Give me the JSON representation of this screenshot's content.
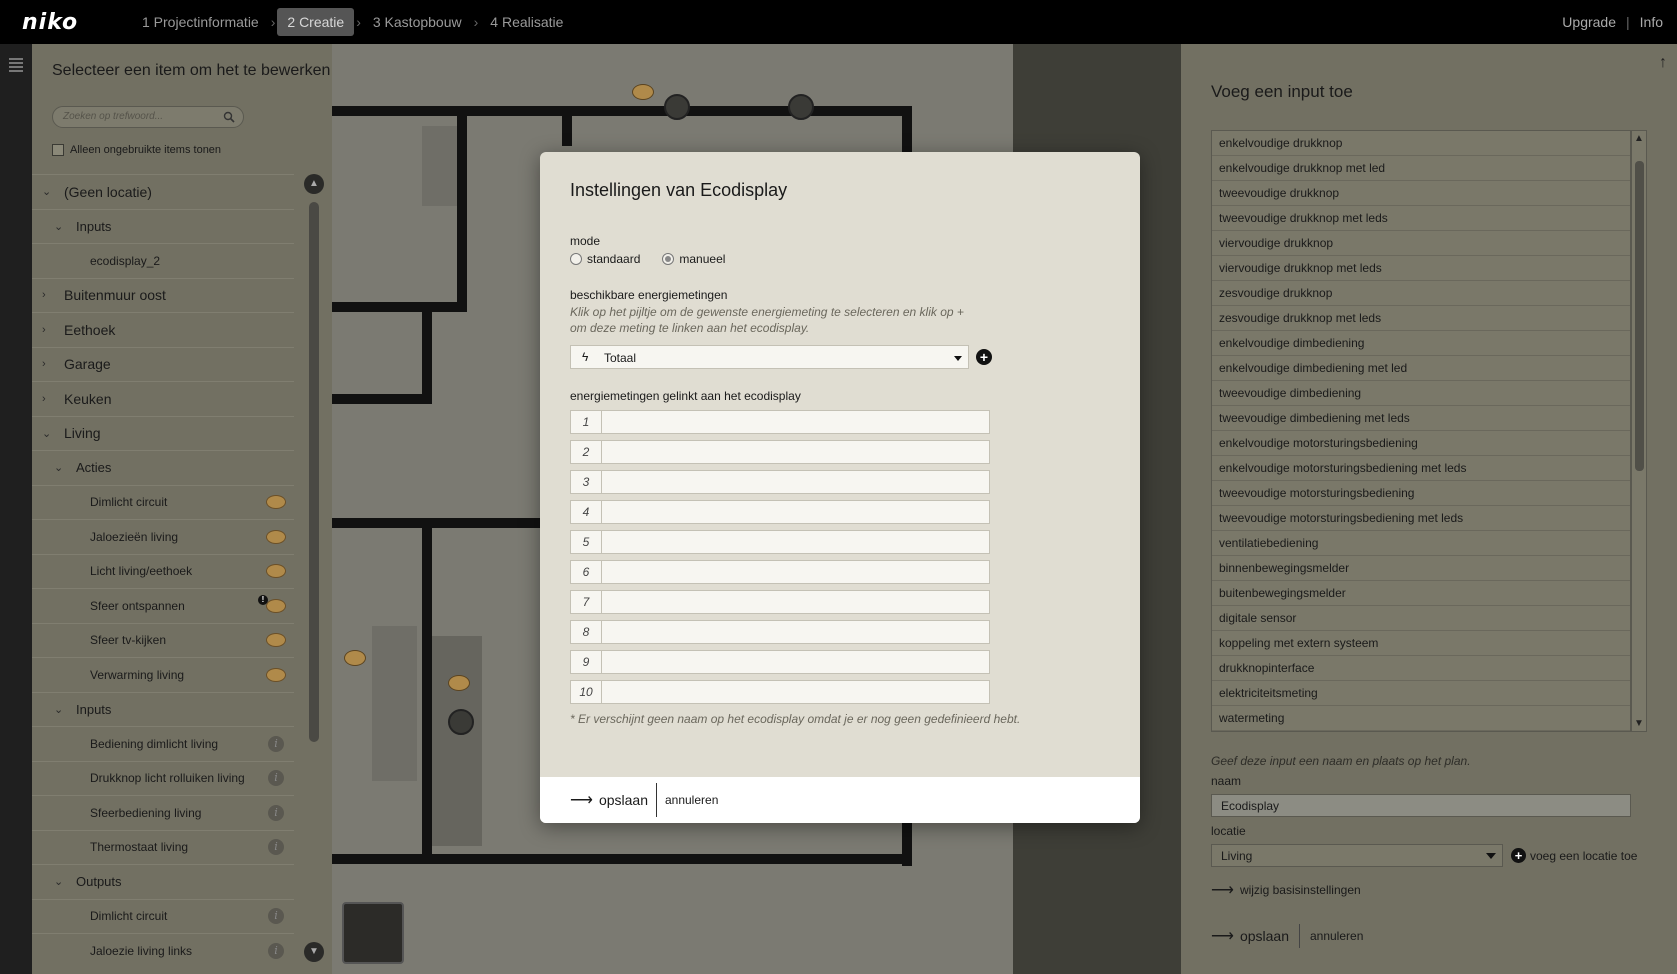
{
  "topbar": {
    "logo": "niko",
    "steps": [
      "1 Projectinformatie",
      "2 Creatie",
      "3 Kastopbouw",
      "4 Realisatie"
    ],
    "upgrade": "Upgrade",
    "info": "Info"
  },
  "left": {
    "title": "Selecteer een item om het te bewerken",
    "search_placeholder": "Zoeken op trefwoord...",
    "unused_only": "Alleen ongebruikte items tonen",
    "tree": [
      {
        "label": "(Geen locatie)",
        "level": 1,
        "arrow": "down"
      },
      {
        "label": "Inputs",
        "level": 2,
        "arrow": "down"
      },
      {
        "label": "ecodisplay_2",
        "level": 3
      },
      {
        "label": "Buitenmuur oost",
        "level": 1,
        "arrow": "right"
      },
      {
        "label": "Eethoek",
        "level": 1,
        "arrow": "right"
      },
      {
        "label": "Garage",
        "level": 1,
        "arrow": "right"
      },
      {
        "label": "Keuken",
        "level": 1,
        "arrow": "right"
      },
      {
        "label": "Living",
        "level": 1,
        "arrow": "down"
      },
      {
        "label": "Acties",
        "level": 2,
        "arrow": "down"
      },
      {
        "label": "Dimlicht circuit",
        "level": 3,
        "icon": "bubble"
      },
      {
        "label": "Jaloezieën living",
        "level": 3,
        "icon": "bubble"
      },
      {
        "label": "Licht living/eethoek",
        "level": 3,
        "icon": "bubble"
      },
      {
        "label": "Sfeer ontspannen",
        "level": 3,
        "icon": "bubble-warning"
      },
      {
        "label": "Sfeer tv-kijken",
        "level": 3,
        "icon": "bubble"
      },
      {
        "label": "Verwarming living",
        "level": 3,
        "icon": "bubble"
      },
      {
        "label": "Inputs",
        "level": 2,
        "arrow": "down"
      },
      {
        "label": "Bediening dimlicht living",
        "level": 3,
        "icon": "info"
      },
      {
        "label": "Drukknop licht rolluiken living",
        "level": 3,
        "icon": "info"
      },
      {
        "label": "Sfeerbediening living",
        "level": 3,
        "icon": "info"
      },
      {
        "label": "Thermostaat living",
        "level": 3,
        "icon": "info"
      },
      {
        "label": "Outputs",
        "level": 2,
        "arrow": "down"
      },
      {
        "label": "Dimlicht circuit",
        "level": 3,
        "icon": "info"
      },
      {
        "label": "Jaloezie living links",
        "level": 3,
        "icon": "info"
      }
    ]
  },
  "modal": {
    "title": "Instellingen van Ecodisplay",
    "mode_label": "mode",
    "mode_options": [
      "standaard",
      "manueel"
    ],
    "mode_selected": "manueel",
    "available_label": "beschikbare energiemetingen",
    "available_hint": "Klik op het pijltje om de gewenste energiemeting te selecteren en klik op + om deze meting te linken aan het ecodisplay.",
    "selected_measurement": "Totaal",
    "linked_label": "energiemetingen gelinkt aan het ecodisplay",
    "slots": [
      "1",
      "2",
      "3",
      "4",
      "5",
      "6",
      "7",
      "8",
      "9",
      "10"
    ],
    "note": "* Er verschijnt geen naam op het ecodisplay omdat je er nog geen gedefinieerd hebt.",
    "save": "opslaan",
    "cancel": "annuleren"
  },
  "right": {
    "title": "Voeg een input toe",
    "inputs": [
      "enkelvoudige drukknop",
      "enkelvoudige drukknop met led",
      "tweevoudige drukknop",
      "tweevoudige drukknop met leds",
      "viervoudige drukknop",
      "viervoudige drukknop met leds",
      "zesvoudige drukknop",
      "zesvoudige drukknop met leds",
      "enkelvoudige dimbediening",
      "enkelvoudige dimbediening met led",
      "tweevoudige dimbediening",
      "tweevoudige dimbediening met leds",
      "enkelvoudige motorsturingsbediening",
      "enkelvoudige motorsturingsbediening met leds",
      "tweevoudige motorsturingsbediening",
      "tweevoudige motorsturingsbediening met leds",
      "ventilatiebediening",
      "binnenbewegingsmelder",
      "buitenbewegingsmelder",
      "digitale sensor",
      "koppeling met extern systeem",
      "drukknopinterface",
      "elektriciteitsmeting",
      "watermeting"
    ],
    "hint": "Geef deze input een naam en plaats op het plan.",
    "name_label": "naam",
    "name_value": "Ecodisplay",
    "location_label": "locatie",
    "location_value": "Living",
    "add_location": "voeg een locatie toe",
    "change_settings": "wijzig basisinstellingen",
    "save": "opslaan",
    "cancel": "annuleren"
  }
}
